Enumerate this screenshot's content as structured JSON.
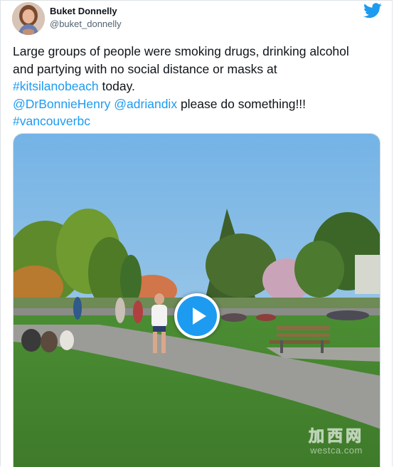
{
  "tweet": {
    "author_name": "Buket Donnelly",
    "author_handle": "@buket_donnelly",
    "text_line1": "Large groups of people were smoking drugs, drinking alcohol",
    "text_line2": "and partying with no social distance or masks at",
    "hashtag_kitsilano": "#kitsilanobeach",
    "text_today": " today.",
    "mention_bonnie": "@DrBonnieHenry",
    "mention_adrian": "@adriandix",
    "text_please": " please do something!!!",
    "hashtag_vancouver": "#vancouverbc"
  },
  "media": {
    "play_icon": "play-icon",
    "watermark_cn": "加西网",
    "watermark_en": "westca.com"
  },
  "colors": {
    "link": "#1d9bf0",
    "text": "#0f1419",
    "secondary": "#536471"
  },
  "icons": {
    "logo": "twitter-bird-icon"
  }
}
